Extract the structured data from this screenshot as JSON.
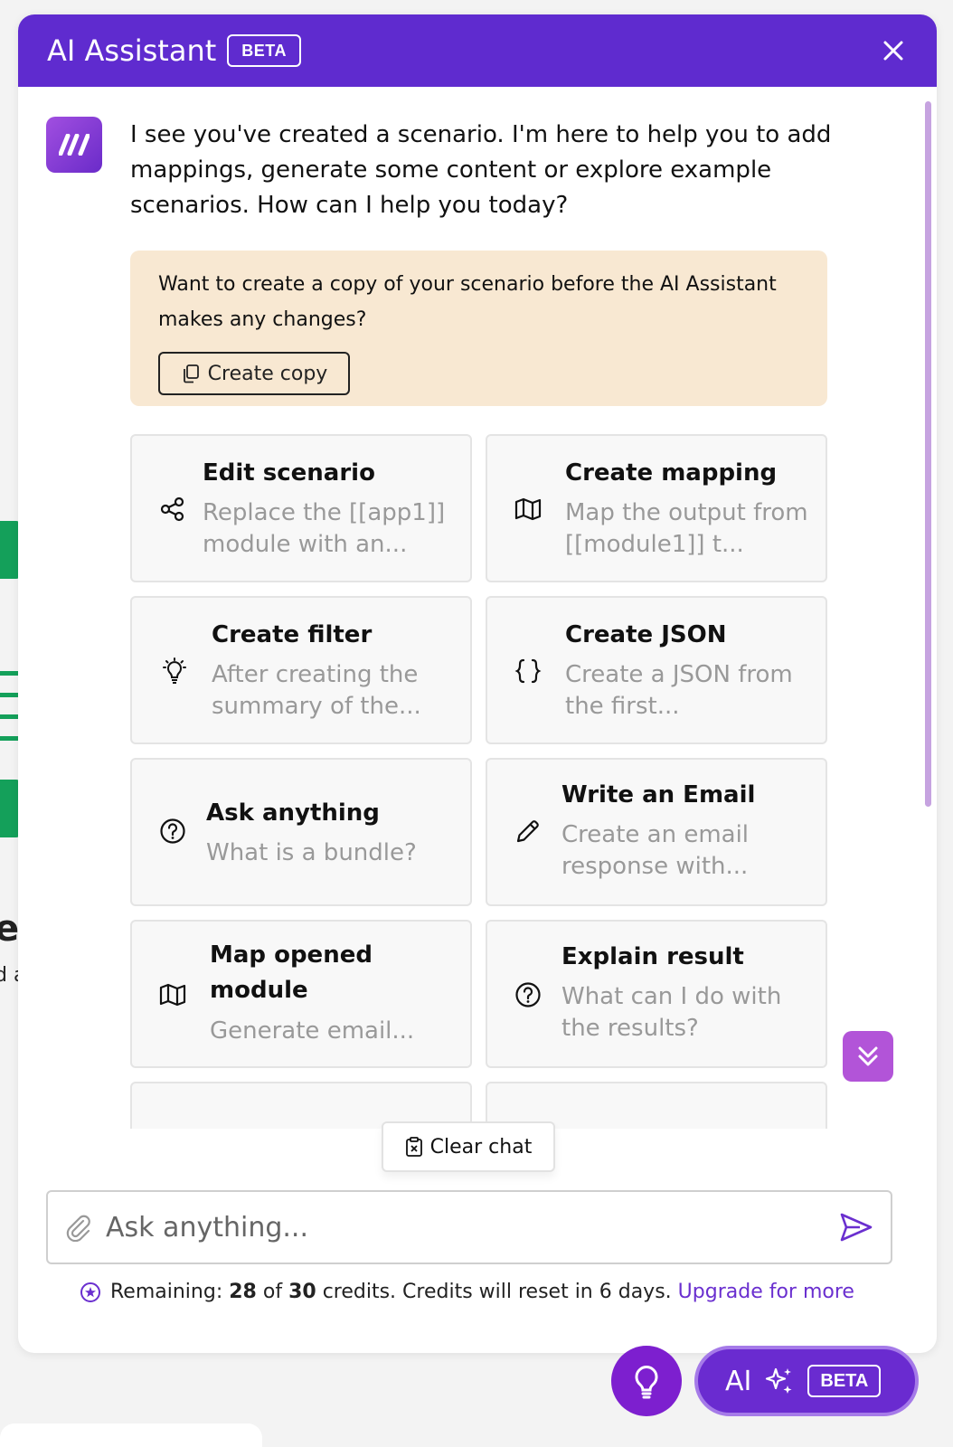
{
  "background": {
    "heading_fragment": "e",
    "sub_fragment": "d a"
  },
  "header": {
    "title": "AI Assistant",
    "badge": "BETA",
    "close_label": "×"
  },
  "chat": {
    "avatar_text": "///",
    "intro": "I see you've created a scenario. I'm here to help you to add mappings, generate some content or explore example scenarios. How can I help you today?",
    "copy_prompt": {
      "text": "Want to create a copy of your scenario before the AI Assistant makes any changes?",
      "button": "Create copy"
    },
    "cards": [
      {
        "title": "Edit scenario",
        "desc": "Replace the [[app1]] module with an...",
        "icon": "share-nodes-icon"
      },
      {
        "title": "Create mapping",
        "desc": "Map the output from [[module1]] t...",
        "icon": "map-icon"
      },
      {
        "title": "Create filter",
        "desc": "After creating the summary of the...",
        "icon": "lightbulb-icon"
      },
      {
        "title": "Create JSON",
        "desc": "Create a JSON from the first...",
        "icon": "braces-icon"
      },
      {
        "title": "Ask anything",
        "desc": "What is a bundle?",
        "icon": "question-circle-icon"
      },
      {
        "title": "Write an Email",
        "desc": "Create an email response with...",
        "icon": "pencil-icon"
      },
      {
        "title": "Map opened module",
        "desc": "Generate email...",
        "icon": "map-icon"
      },
      {
        "title": "Explain result",
        "desc": "What can I do with the results?",
        "icon": "question-circle-icon"
      }
    ]
  },
  "footer": {
    "clear_chat": "Clear chat",
    "input_placeholder": "Ask anything...",
    "credits": {
      "prefix": "Remaining:",
      "used": "28",
      "of": "of",
      "total": "30",
      "suffix": "credits. Credits will reset in 6 days.",
      "link": "Upgrade for more"
    }
  },
  "fab": {
    "ai_label": "AI",
    "badge": "BETA"
  },
  "colors": {
    "header": "#5f2bcf",
    "accent": "#6a2fcf",
    "copy_box": "#f8e8d2",
    "scroll_button": "#b254d8"
  }
}
